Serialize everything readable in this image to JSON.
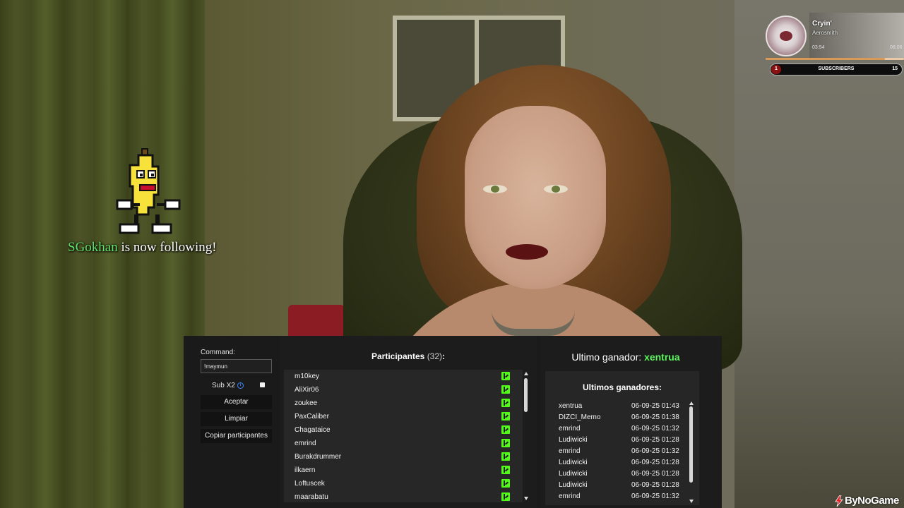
{
  "alert": {
    "username": "SGokhan",
    "message": " is now following!"
  },
  "music": {
    "title": "Cryin'",
    "artist": "Aerosmith",
    "time_current": "03:54",
    "time_total": "06:06",
    "progress_fraction": 0.86
  },
  "sub_goal": {
    "start": "1",
    "label": "SUBSCRIBERS",
    "target": "15"
  },
  "controls": {
    "command_label": "Command:",
    "command_value": "!maymun",
    "sub_label": "Sub X2",
    "info_glyph": "i",
    "accept_label": "Aceptar",
    "clear_label": "Limpiar",
    "copy_label": "Copiar participantes"
  },
  "participants": {
    "title": "Participantes",
    "count": "(32)",
    "suffix": ":",
    "items": [
      {
        "name": "m10key",
        "platform_icon": "kick-icon"
      },
      {
        "name": "AliXir06",
        "platform_icon": "kick-icon"
      },
      {
        "name": "zoukee",
        "platform_icon": "kick-icon"
      },
      {
        "name": "PaxCaliber",
        "platform_icon": "kick-icon"
      },
      {
        "name": "Chagataice",
        "platform_icon": "kick-icon"
      },
      {
        "name": "emrind",
        "platform_icon": "kick-icon"
      },
      {
        "name": "Burakdrummer",
        "platform_icon": "kick-icon"
      },
      {
        "name": "ilkaern",
        "platform_icon": "kick-icon"
      },
      {
        "name": "Loftuscek",
        "platform_icon": "kick-icon"
      },
      {
        "name": "maarabatu",
        "platform_icon": "kick-icon"
      }
    ]
  },
  "winners": {
    "last_label": "Ultimo ganador:",
    "last_name": "xentrua",
    "list_title": "Ultimos ganadores:",
    "items": [
      {
        "name": "xentrua",
        "date": "06-09-25 01:43"
      },
      {
        "name": "DIZCI_Memo",
        "date": "06-09-25 01:38"
      },
      {
        "name": "emrind",
        "date": "06-09-25 01:32"
      },
      {
        "name": "Ludiwicki",
        "date": "06-09-25 01:28"
      },
      {
        "name": "emrind",
        "date": "06-09-25 01:32"
      },
      {
        "name": "Ludiwicki",
        "date": "06-09-25 01:28"
      },
      {
        "name": "Ludiwicki",
        "date": "06-09-25 01:28"
      },
      {
        "name": "Ludiwicki",
        "date": "06-09-25 01:28"
      },
      {
        "name": "emrind",
        "date": "06-09-25 01:32"
      }
    ]
  },
  "watermark": {
    "text": "ByNoGame"
  },
  "colors": {
    "accent_green": "#5cf35c",
    "kick_green": "#53fc18",
    "panel_bg": "#1a1a1a",
    "goal_fill": "#8b1111"
  }
}
